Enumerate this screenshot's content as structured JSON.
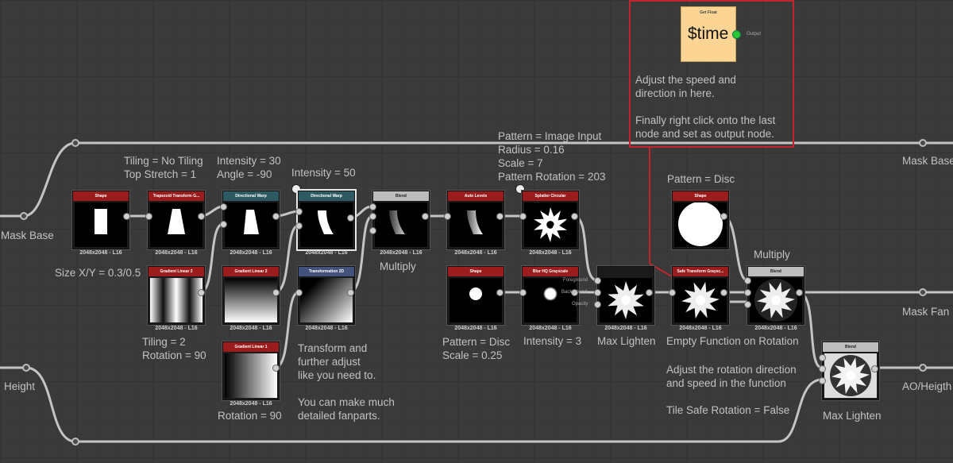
{
  "comment": {
    "node_title": "Get Float",
    "node_text": "$time",
    "output_label": "Output",
    "text": "Adjust the speed and\ndirection in here.\n\nFinally right click onto the last\nnode and set as output node."
  },
  "inputs": {
    "mask_base": "Mask Base",
    "height": "Height"
  },
  "outputs": {
    "mask_base": "Mask Base",
    "mask_fan": "Mask Fan",
    "ao_height": "AO/Heigth"
  },
  "nodes": {
    "shape1": {
      "title": "Shape",
      "res": "2048x2048 - L16"
    },
    "trapezoid": {
      "title": "Trapezoid Transform G...",
      "res": "2048x2048 - L16"
    },
    "dirwarp1": {
      "title": "Directional Warp",
      "res": "2048x2048 - L16"
    },
    "dirwarp2": {
      "title": "Directional Warp",
      "res": "2048x2048 - L16"
    },
    "blend1": {
      "title": "Blend",
      "res": "2048x2048 - L16"
    },
    "autolevels": {
      "title": "Auto Levels",
      "res": "2048x2048 - L16"
    },
    "splatter": {
      "title": "Splatter Circular",
      "res": "2048x2048 - L16"
    },
    "gradient_a": {
      "title": "Gradient Linear 2",
      "res": "2048x2048 - L16"
    },
    "gradient_b": {
      "title": "Gradient Linear 2",
      "res": "2048x2048 - L16"
    },
    "transform2d": {
      "title": "Transformation 2D",
      "res": "2048x2048 - L16"
    },
    "gradient1": {
      "title": "Gradient Linear 1",
      "res": "2048x2048 - L16"
    },
    "shape2": {
      "title": "Shape",
      "res": "2048x2048 - L16"
    },
    "blurhq": {
      "title": "Blur HQ Grayscale",
      "res": "2048x2048 - L16"
    },
    "maxlighten1": {
      "title": "",
      "res": "2048x2048 - L16",
      "ports": [
        "Foreground",
        "Background",
        "Opacity"
      ]
    },
    "safetransform": {
      "title": "Safe Transform Graysc...",
      "res": "2048x2048 - L16"
    },
    "shape3": {
      "title": "Shape",
      "res": "2048x2048 - L16"
    },
    "blend2": {
      "title": "Blend",
      "res": "2048x2048 - L16"
    },
    "blend3": {
      "title": "Blend",
      "res": "2048x2048 - L16"
    }
  },
  "labels": {
    "tiling": "Tiling = No Tiling\nTop Stretch = 1",
    "intensity30": "Intensity = 30\nAngle = -90",
    "intensity50": "Intensity = 50",
    "pattern_image": "Pattern = Image Input\nRadius = 0.16\nScale = 7\nPattern Rotation = 203",
    "pattern_disc_top": "Pattern = Disc",
    "size": "Size X/Y = 0.3/0.5",
    "multiply1": "Multiply",
    "multiply2": "Multiply",
    "tiling2": "Tiling = 2\nRotation = 90",
    "transform_note": "Transform and\nfurther adjust\nlike you need to.\n\nYou can make much\ndetailed fanparts.",
    "rotation90": "Rotation = 90",
    "pattern_disc": "Pattern = Disc\nScale = 0.25",
    "intensity3": "Intensity = 3",
    "max_lighten1": "Max Lighten",
    "empty_function": "Empty Function on Rotation",
    "adjust_rotation": "Adjust the rotation direction\nand speed in the function\n\nTile Safe Rotation = False",
    "max_lighten2": "Max Lighten"
  },
  "colors": {
    "background": "#3a3a3a",
    "comment_border": "#c0262c",
    "getfloat_bg": "#fcd595",
    "output_port": "#29c535",
    "header_red": "#9b1c1c",
    "header_teal": "#2d5a63",
    "header_gray": "#bdbdbd",
    "header_blue": "#42527a"
  }
}
